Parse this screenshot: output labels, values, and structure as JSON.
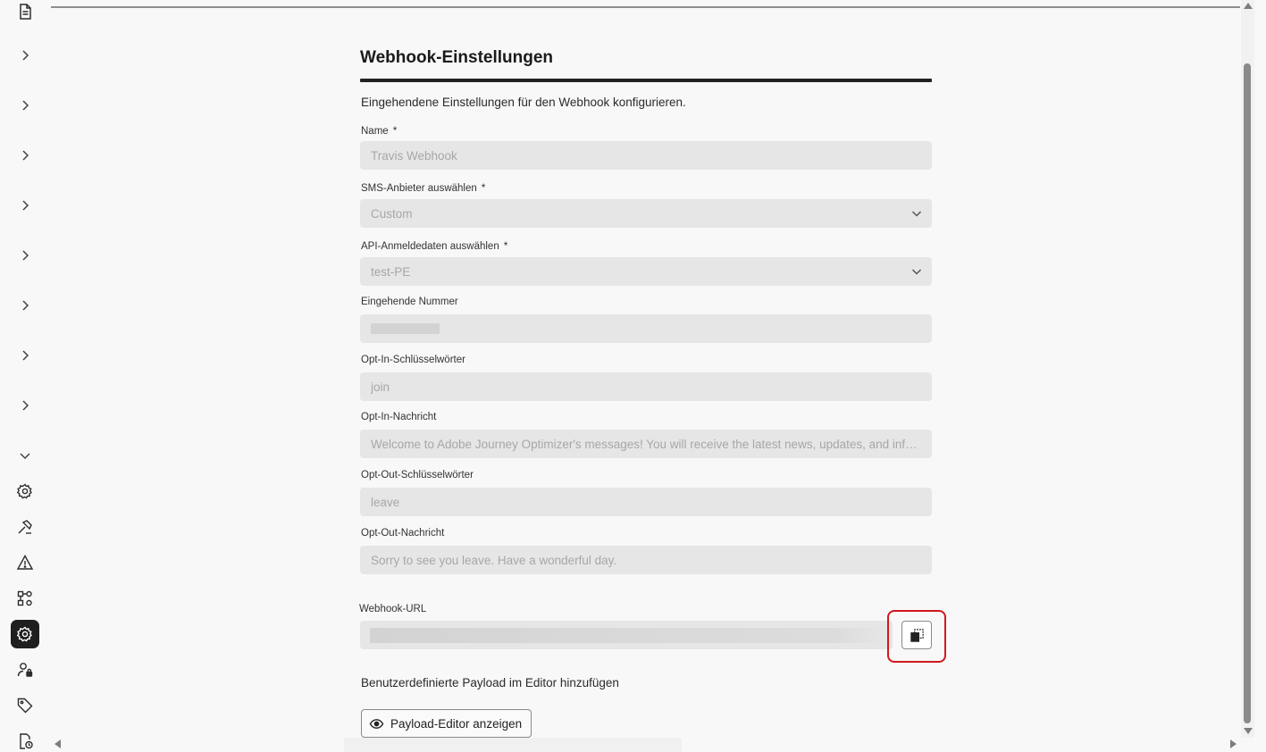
{
  "form": {
    "title": "Webhook-Einstellungen",
    "description": "Eingehendene Einstellungen für den Webhook konfigurieren.",
    "required_marker": "*",
    "fields": {
      "name": {
        "label": "Name",
        "value": "Travis Webhook"
      },
      "sms_provider": {
        "label": "SMS-Anbieter auswählen",
        "value": "Custom"
      },
      "api_credentials": {
        "label": "API-Anmeldedaten auswählen",
        "value": "test-PE"
      },
      "inbound_number": {
        "label": "Eingehende Nummer",
        "value": ""
      },
      "optin_keywords": {
        "label": "Opt-In-Schlüsselwörter",
        "value": "join"
      },
      "optin_message": {
        "label": "Opt-In-Nachricht",
        "value": "Welcome to Adobe Journey Optimizer's messages! You will receive the latest news, updates, and informati…"
      },
      "optout_keywords": {
        "label": "Opt-Out-Schlüsselwörter",
        "value": "leave"
      },
      "optout_message": {
        "label": "Opt-Out-Nachricht",
        "value": "Sorry to see you leave. Have a wonderful day."
      }
    },
    "webhook_url": {
      "label": "Webhook-URL"
    },
    "payload_text": "Benutzerdefinierte Payload im Editor hinzufügen",
    "payload_button": "Payload-Editor anzeigen"
  },
  "colors": {
    "highlight": "#d0171f",
    "active_rail": "#1f1f1f",
    "field_bg": "#e6e6e6"
  },
  "rail_icons": [
    "document-icon",
    "settings-icon",
    "hammer-icon",
    "alert-icon",
    "workflow-settings-icon",
    "channel-settings-icon",
    "user-lock-icon",
    "tag-icon",
    "document-clock-icon"
  ]
}
